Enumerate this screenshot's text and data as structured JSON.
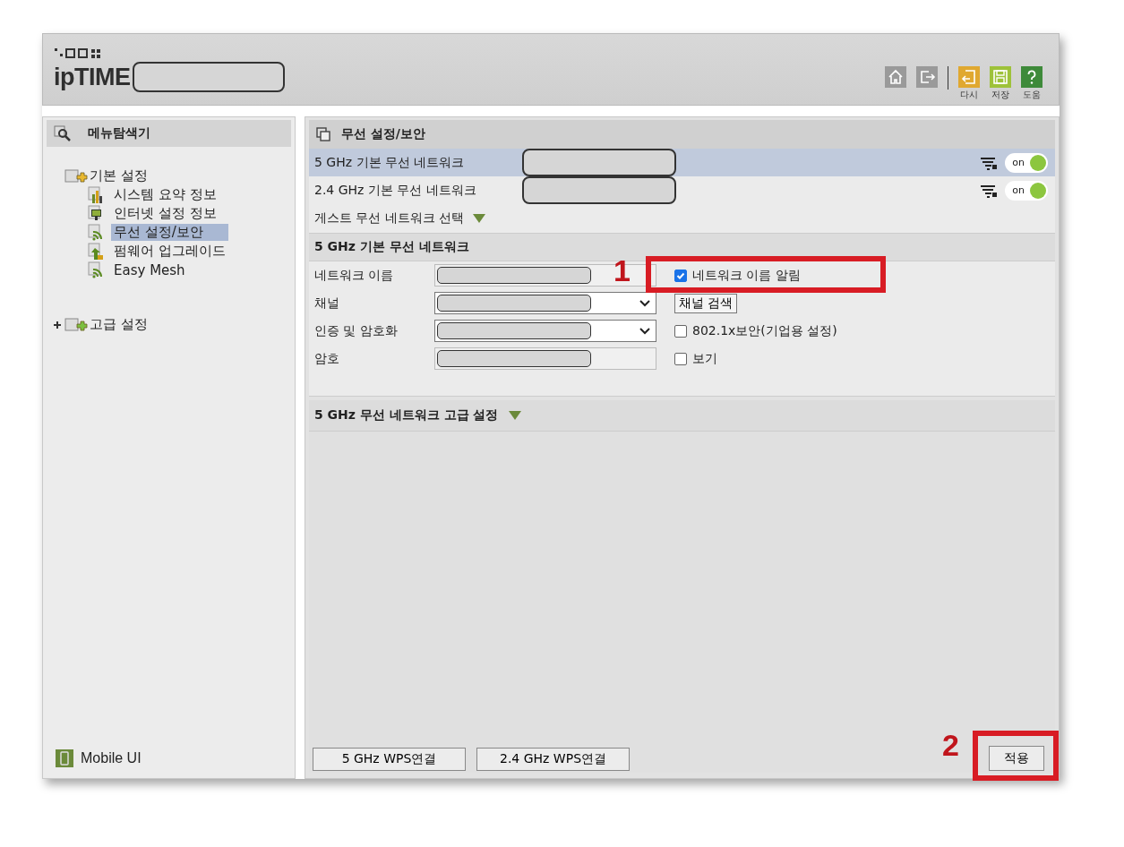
{
  "header": {
    "logo_text": "ipTIME",
    "toolbar": [
      {
        "kind": "home"
      },
      {
        "kind": "logout"
      },
      {
        "kind": "reset",
        "label": "다시"
      },
      {
        "kind": "save",
        "label": "저장"
      },
      {
        "kind": "help",
        "label": "도움"
      }
    ]
  },
  "sidebar": {
    "title": "메뉴탐색기",
    "tree": [
      {
        "label": "기본 설정",
        "expanded": true,
        "children": [
          {
            "label": "시스템 요약 정보",
            "kind": "chart",
            "selected": false
          },
          {
            "label": "인터넷 설정 정보",
            "kind": "monitor",
            "selected": false
          },
          {
            "label": "무선 설정/보안",
            "kind": "wifi",
            "selected": true
          },
          {
            "label": "펌웨어 업그레이드",
            "kind": "upload",
            "selected": false
          },
          {
            "label": "Easy Mesh",
            "kind": "wifi",
            "selected": false
          }
        ]
      },
      {
        "label": "고급 설정",
        "expanded": false
      }
    ],
    "footer": "Mobile UI"
  },
  "main": {
    "title": "무선 설정/보안",
    "networks": [
      {
        "label": "5 GHz 기본 무선 네트워크",
        "selected": true,
        "on": true,
        "toggle_label": "on"
      },
      {
        "label": "2.4 GHz 기본 무선 네트워크",
        "selected": false,
        "on": true,
        "toggle_label": "on"
      }
    ],
    "guest": "게스트 무선 네트워크 선택",
    "section_title": "5 GHz 기본 무선 네트워크",
    "form": [
      {
        "label": "네트워크 이름",
        "kind": "text",
        "option": {
          "kind": "checkbox",
          "label": "네트워크 이름 알림",
          "checked": true,
          "annotation": "1"
        }
      },
      {
        "label": "채널",
        "kind": "select",
        "option": {
          "kind": "button",
          "label": "채널 검색"
        }
      },
      {
        "label": "인증 및 암호화",
        "kind": "select",
        "option": {
          "kind": "checkbox",
          "label": "802.1x보안(기업용 설정)",
          "checked": false
        }
      },
      {
        "label": "암호",
        "kind": "password",
        "option": {
          "kind": "checkbox",
          "label": "보기",
          "checked": false
        }
      }
    ],
    "advanced": "5 GHz 무선 네트워크 고급 설정",
    "wps_buttons": [
      "5 GHz WPS연결",
      "2.4 GHz WPS연결"
    ],
    "apply": {
      "label": "적용",
      "annotation": "2"
    }
  }
}
